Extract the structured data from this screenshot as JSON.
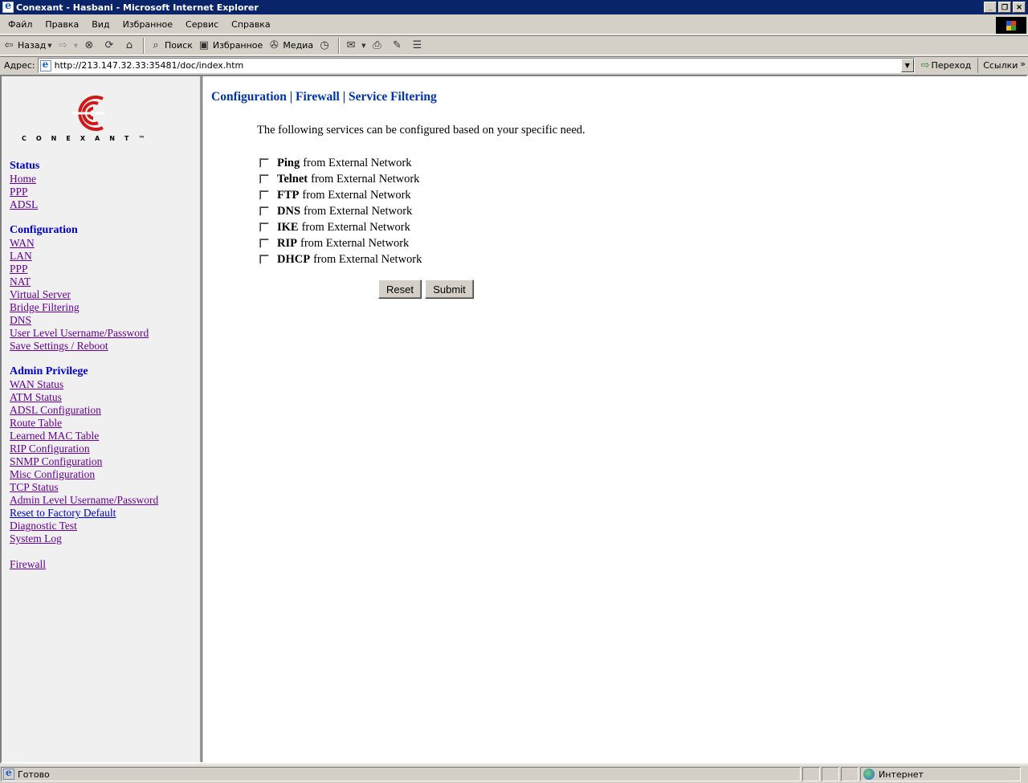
{
  "window": {
    "title": "Conexant - Hasbani - Microsoft Internet Explorer"
  },
  "menu": [
    "Файл",
    "Правка",
    "Вид",
    "Избранное",
    "Сервис",
    "Справка"
  ],
  "toolbar": {
    "back": "Назад",
    "search": "Поиск",
    "favorites": "Избранное",
    "media": "Медиа"
  },
  "address": {
    "label": "Адрес:",
    "url": "http://213.147.32.33:35481/doc/index.htm",
    "go": "Переход",
    "links": "Ссылки"
  },
  "logo": {
    "word": "CONEXANT™"
  },
  "nav": {
    "status_heading": "Status",
    "status_links": [
      "Home",
      "PPP",
      "ADSL"
    ],
    "config_heading": "Configuration",
    "config_links": [
      "WAN",
      "LAN",
      "PPP",
      "NAT",
      "Virtual Server",
      "Bridge Filtering",
      "DNS",
      "User Level Username/Password",
      "Save Settings / Reboot"
    ],
    "admin_heading": "Admin Privilege",
    "admin_links": [
      "WAN Status",
      "ATM Status",
      "ADSL Configuration",
      "Route Table",
      "Learned MAC Table",
      "RIP Configuration",
      "SNMP Configuration",
      "Misc Configuration",
      "TCP Status",
      "Admin Level Username/Password",
      "Reset to Factory Default",
      "Diagnostic Test",
      "System Log"
    ],
    "firewall": "Firewall"
  },
  "main": {
    "title": "Configuration | Firewall | Service Filtering",
    "intro": "The following services can be configured based on your specific need.",
    "suffix": "from External Network",
    "services": [
      {
        "name": "Ping",
        "checked": false
      },
      {
        "name": "Telnet",
        "checked": false
      },
      {
        "name": "FTP",
        "checked": false
      },
      {
        "name": "DNS",
        "checked": false
      },
      {
        "name": "IKE",
        "checked": false
      },
      {
        "name": "RIP",
        "checked": false
      },
      {
        "name": "DHCP",
        "checked": false
      }
    ],
    "reset_label": "Reset",
    "submit_label": "Submit"
  },
  "statusbar": {
    "status": "Готово",
    "zone": "Интернет"
  }
}
